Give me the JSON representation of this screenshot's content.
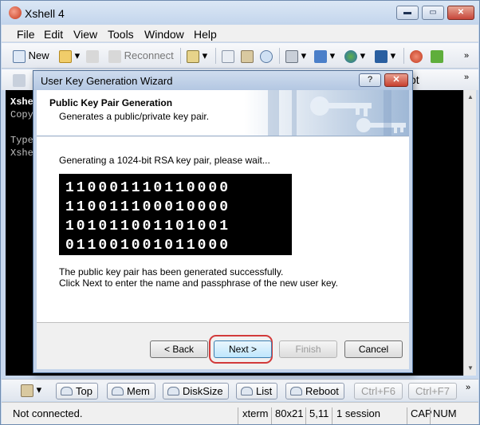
{
  "window": {
    "title": "Xshell 4",
    "min": "▬",
    "max": "▭",
    "close": "✕"
  },
  "menu": [
    "File",
    "Edit",
    "View",
    "Tools",
    "Window",
    "Help"
  ],
  "toolbar": {
    "new_label": "New",
    "reconnect_label": "Reconnect"
  },
  "terminal": {
    "lines": [
      "Xshe",
      "Copy",
      "",
      "Type",
      "Xshe"
    ],
    "tab_fragment": "ot"
  },
  "dialog": {
    "title": "User Key Generation Wizard",
    "help": "?",
    "close": "✕",
    "header_title": "Public Key Pair Generation",
    "header_subtitle": "Generates a public/private key pair.",
    "generating_message": "Generating a 1024-bit RSA key pair, please wait...",
    "matrix_rows": [
      "110001110110000",
      "110011100010000",
      "101011001101001",
      "011001001011000"
    ],
    "done_line1": "The public key pair has been generated successfully.",
    "done_line2": "Click Next to enter the name and passphrase of the new user key.",
    "buttons": {
      "back": "< Back",
      "next": "Next >",
      "finish": "Finish",
      "cancel": "Cancel"
    }
  },
  "quickbar": {
    "buttons": [
      "Top",
      "Mem",
      "DiskSize",
      "List",
      "Reboot"
    ],
    "disabled": [
      "Ctrl+F6",
      "Ctrl+F7"
    ]
  },
  "status": {
    "connection": "Not connected.",
    "term": "xterm",
    "size": "80x21",
    "cursor": "5,11",
    "sessions": "1 session",
    "cap": "CAP",
    "num": "NUM"
  },
  "colors": {
    "highlight_ring": "#d23a3a",
    "title_bg": "#c9d9ee"
  }
}
